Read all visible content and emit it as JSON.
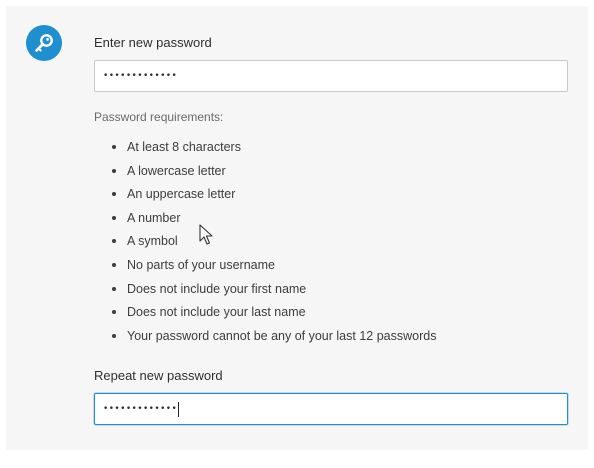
{
  "colors": {
    "accent": "#1f8fcf",
    "panel_background": "#f6f6f6",
    "text": "#2f2f2f",
    "muted_text": "#6a6a6a"
  },
  "icons": {
    "badge": "key-icon",
    "pointer": "mouse-cursor-icon"
  },
  "new_password": {
    "label": "Enter new password",
    "value": "•••••••••••••"
  },
  "requirements": {
    "title": "Password requirements:",
    "items": [
      "At least 8 characters",
      "A lowercase letter",
      "An uppercase letter",
      "A number",
      "A symbol",
      "No parts of your username",
      "Does not include your first name",
      "Does not include your last name",
      "Your password cannot be any of your last 12 passwords"
    ]
  },
  "repeat_password": {
    "label": "Repeat new password",
    "value": "•••••••••••••",
    "focused": true
  }
}
